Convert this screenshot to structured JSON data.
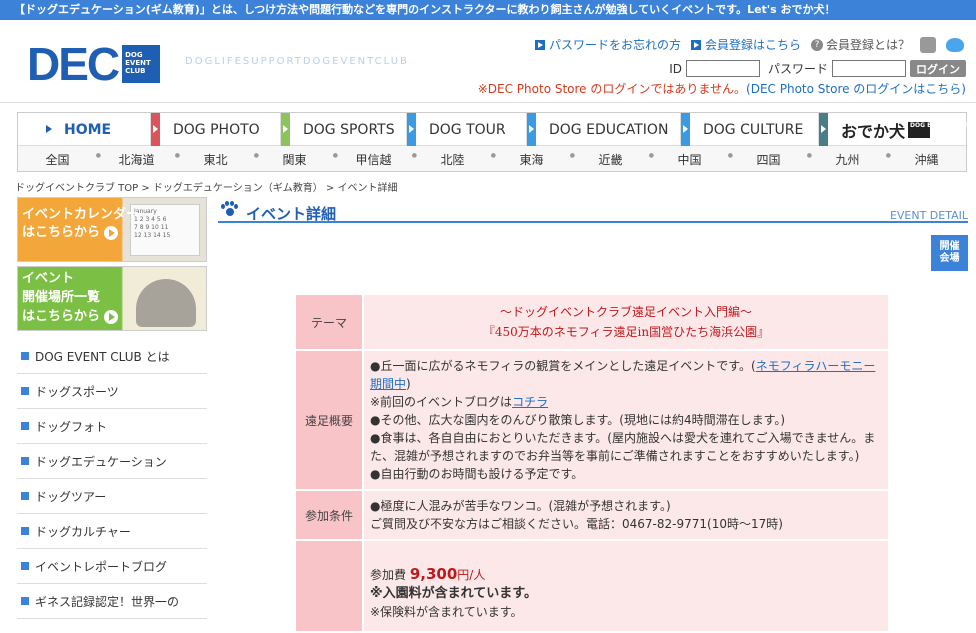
{
  "topbar": {
    "text": "【ドッグエデュケーション(ギム教育)」とは、しつけ方法や問題行動などを専門のインストラクターに教わり飼主さんが勉強していくイベントです。Let's おでか犬！"
  },
  "logo": {
    "main": "DEC",
    "box": "DOG EVENT CLUB",
    "tagline": "DOGLIFESUPPORTDOGEVENTCLUB"
  },
  "header": {
    "password_link": "パスワードをお忘れの方",
    "register_link": "会員登録はこちら",
    "about_member": "会員登録とは？",
    "id_label": "ID",
    "password_label": "パスワード",
    "login_button": "ログイン",
    "photo_notice": "※DEC Photo Store のログインではありません。",
    "photo_link": "(DEC Photo Store のログインはこちら)"
  },
  "nav": {
    "items": [
      {
        "label": "HOME",
        "color": "#1e5fb4"
      },
      {
        "label": "DOG PHOTO",
        "color": "#d9545b"
      },
      {
        "label": "DOG SPORTS",
        "color": "#8dc35d"
      },
      {
        "label": "DOG TOUR",
        "color": "#3b9ae0"
      },
      {
        "label": "DOG EDUCATION",
        "color": "#3b9ae0"
      },
      {
        "label": "DOG CULTURE",
        "color": "#3b9ae0"
      },
      {
        "label": "おでか犬",
        "color": "#4a7d8a"
      }
    ],
    "odekake_box": "DOG EVENT CLUB",
    "regions": [
      "全国",
      "北海道",
      "東北",
      "関東",
      "甲信越",
      "北陸",
      "東海",
      "近畿",
      "中国",
      "四国",
      "九州",
      "沖縄"
    ]
  },
  "breadcrumb": "ドッグイベントクラブ TOP > ドッグエデュケーション（ギム教育） > イベント詳細",
  "sidebar": {
    "banner1": {
      "line1": "イベントカレンダー",
      "line2": "はこちらから",
      "cal_month": "January"
    },
    "banner2": {
      "line1": "イベント",
      "line2": "開催場所一覧",
      "line3": "はこちらから"
    },
    "menu": [
      "DOG EVENT CLUB とは",
      "ドッグスポーツ",
      "ドッグフォト",
      "ドッグエデュケーション",
      "ドッグツアー",
      "ドッグカルチャー",
      "イベントレポートブログ",
      "ギネス記録認定！世界一の"
    ]
  },
  "main": {
    "title": "イベント詳細",
    "subtitle": "EVENT DETAIL",
    "venue_button": [
      "開催",
      "会場"
    ],
    "table": {
      "theme_label": "テーマ",
      "theme_line1": "〜ドッグイベントクラブ遠足イベント入門編〜",
      "theme_line2": "『450万本のネモフィラ遠足in国営ひたち海浜公園』",
      "overview_label": "遠足概要",
      "overview_1a": "●丘一面に広がるネモフィラの観賞をメインとした遠足イベントです。(",
      "overview_1link": "ネモフィラハーモニー期間中",
      "overview_1b": ")",
      "overview_2a": "※前回のイベントブログは",
      "overview_2link": "コチラ",
      "overview_3": "●その他、広大な園内をのんびり散策します。(現地には約4時間滞在します。)",
      "overview_4": "●食事は、各自自由におとりいただきます。(屋内施設へは愛犬を連れてご入場できません。また、混雑が予想されますのでお弁当等を事前にご準備されますことをおすすめいたします。)",
      "overview_5": "●自由行動のお時間も設ける予定です。",
      "condition_label": "参加条件",
      "condition_1": "●極度に人混みが苦手なワンコ。(混雑が予想されます。)",
      "condition_2": "ご質問及び不安な方はご相談ください。電話：0467-82-9771(10時〜17時)",
      "fee_label": "参加費",
      "fee_value": "9,300",
      "fee_unit": "円/人",
      "fee_note1": "※入園料が含まれています。",
      "fee_note2": "※保険料が含まれています。"
    }
  }
}
